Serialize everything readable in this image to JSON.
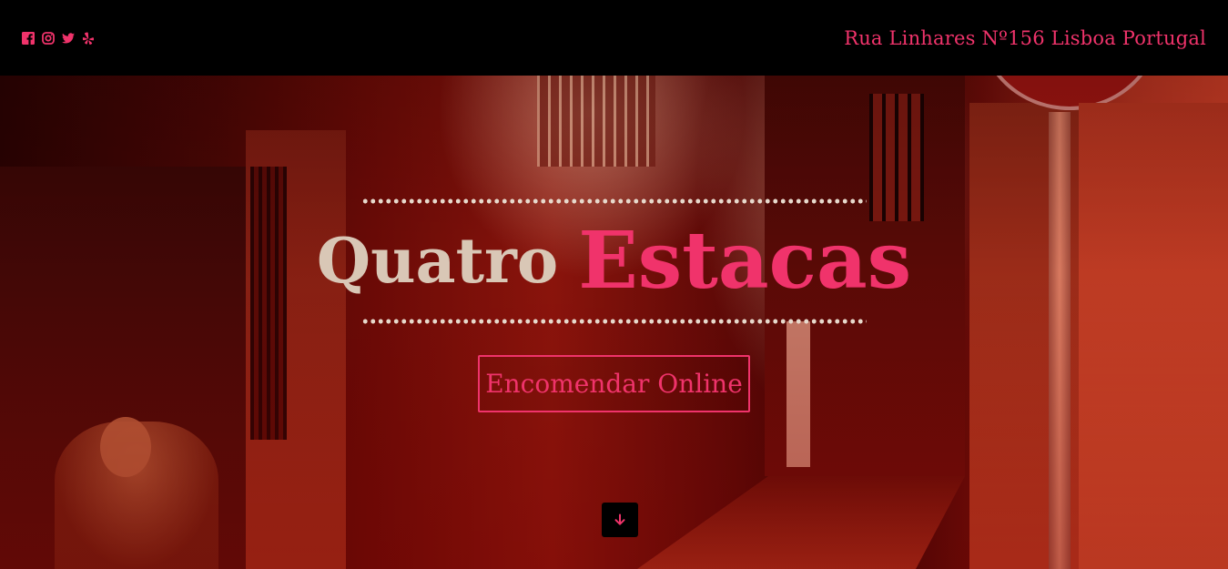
{
  "header": {
    "social": [
      {
        "name": "facebook-icon"
      },
      {
        "name": "instagram-icon"
      },
      {
        "name": "twitter-icon"
      },
      {
        "name": "yelp-icon"
      }
    ],
    "address": "Rua Linhares Nº156 Lisboa Portugal"
  },
  "hero": {
    "title_word1": "Quatro",
    "title_word2": "Estacas",
    "order_button": "Encomendar Online",
    "scroll_icon": "arrow-down-icon"
  },
  "colors": {
    "accent": "#f0336b",
    "title_light": "#d9c7b6",
    "topbar": "#000000"
  }
}
